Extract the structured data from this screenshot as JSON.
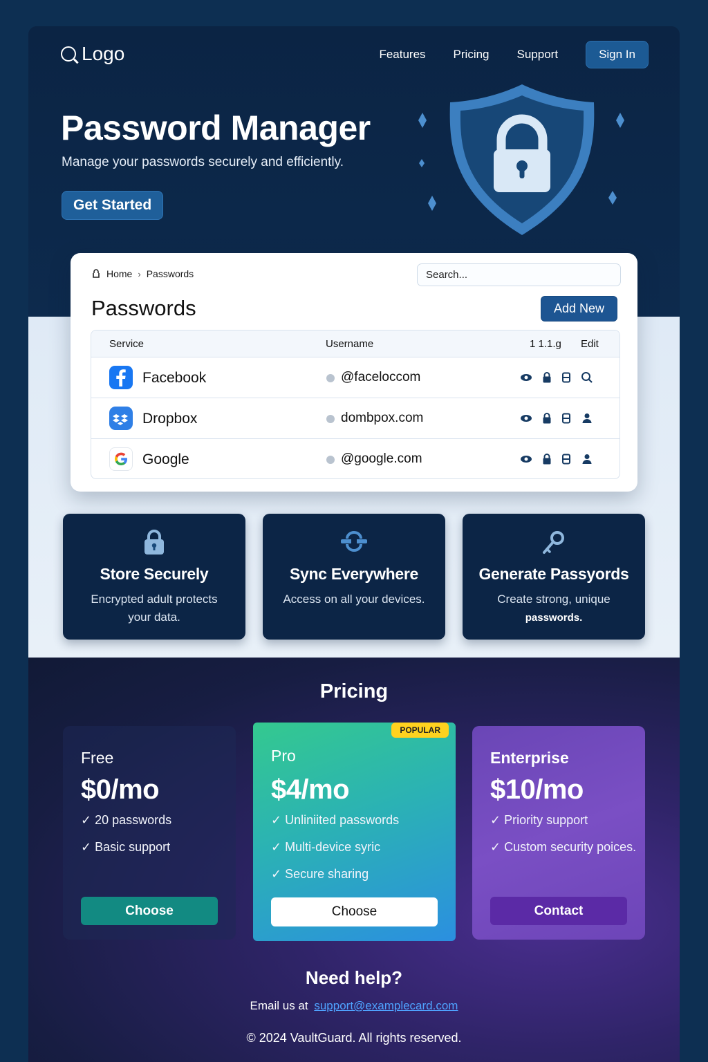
{
  "nav": {
    "logo_text": "Logo",
    "links": [
      "Features",
      "Pricing",
      "Support"
    ],
    "signin_label": "Sign In"
  },
  "hero": {
    "title": "Password Manager",
    "subtitle": "Manage your passwords securely and efficiently.",
    "cta_label": "Get Started"
  },
  "panel": {
    "breadcrumb": [
      "Home",
      "Passwords"
    ],
    "search_placeholder": "Search...",
    "title": "Passwords",
    "add_new_label": "Add New",
    "columns": [
      "Service",
      "Username",
      "1 1.1.g",
      "Edit"
    ],
    "rows": [
      {
        "service": "Facebook",
        "username": "@faceloccom",
        "icon": "facebook-icon"
      },
      {
        "service": "Dropbox",
        "username": "dombpox.com",
        "icon": "dropbox-icon"
      },
      {
        "service": "Google",
        "username": "@google.com",
        "icon": "google-icon"
      }
    ]
  },
  "features": [
    {
      "title": "Store Securely",
      "desc_line1": "Encrypted adult protects",
      "desc_line2": "your data.",
      "icon": "lock-icon"
    },
    {
      "title": "Sync Everywhere",
      "desc_line1": "Access on all your devices.",
      "desc_line2": "",
      "icon": "sync-icon"
    },
    {
      "title": "Generate Passyords",
      "desc_line1": "Create strong, unique",
      "desc_line2": "passwords.",
      "icon": "key-icon"
    }
  ],
  "pricing": {
    "title": "Pricing",
    "plans": [
      {
        "name": "Free",
        "price": "$0/mo",
        "features": [
          "✓ 20 passwords",
          "✓ Basic support"
        ],
        "button": "Choose"
      },
      {
        "name": "Pro",
        "price": "$4/mo",
        "badge": "POPULAR",
        "features": [
          "✓ Unliniited passwords",
          "✓ Multi-device syric",
          "✓ Secure sharing"
        ],
        "button": "Choose"
      },
      {
        "name": "Enterprise",
        "price": "$10/mo",
        "features": [
          "✓ Priority support",
          "✓ Custom security poices."
        ],
        "button": "Contact"
      }
    ]
  },
  "help": {
    "title": "Need help?",
    "email_prefix": "Email us at",
    "email": "support@examplecard.com"
  },
  "footer": {
    "copyright": "© 2024 VaultGuard. All rights reserved."
  },
  "colors": {
    "accent": "#1d5592",
    "pro_gradient_start": "#34c98f",
    "pro_gradient_end": "#2b8fe0",
    "enterprise": "#7a4fc4",
    "badge": "#ffd21f"
  }
}
